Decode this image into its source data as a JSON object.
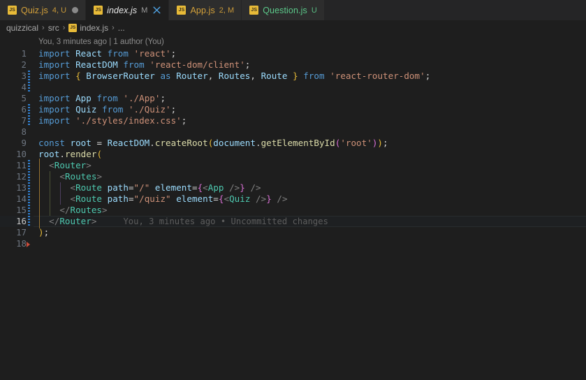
{
  "window": {
    "app": "Visual Studio Code",
    "theme_bg": "#1e1e1e",
    "tabbar_bg": "#252526",
    "accent": "#569cd6"
  },
  "tabs": [
    {
      "label": "Quiz.js",
      "icon": "js-file-icon",
      "badge": "4, U",
      "badge_color": "#d4a13a",
      "label_color": "#d4a13a",
      "active": false,
      "dirty": true,
      "closable": false
    },
    {
      "label": "index.js",
      "icon": "js-file-icon",
      "badge": "M",
      "badge_color": "#a8a8a8",
      "label_color": "#e8e8e8",
      "active": true,
      "dirty": false,
      "closable": true
    },
    {
      "label": "App.js",
      "icon": "js-file-icon",
      "badge": "2, M",
      "badge_color": "#d4a13a",
      "label_color": "#d4a13a",
      "active": false,
      "dirty": false,
      "closable": false
    },
    {
      "label": "Question.js",
      "icon": "js-file-icon",
      "badge": "U",
      "badge_color": "#5cc98a",
      "label_color": "#5cc98a",
      "active": false,
      "dirty": false,
      "closable": false
    }
  ],
  "breadcrumbs": {
    "items": [
      {
        "label": "quizzical",
        "icon": null
      },
      {
        "label": "src",
        "icon": null
      },
      {
        "label": "index.js",
        "icon": "js-file-icon"
      },
      {
        "label": "...",
        "icon": null
      }
    ],
    "separator": "›"
  },
  "blame": {
    "header": "You, 3 minutes ago | 1 author (You)",
    "inline_line": 16,
    "inline_text": "You, 3 minutes ago • Uncommitted changes"
  },
  "editor": {
    "filename": "index.js",
    "language": "javascript",
    "current_line": 16,
    "total_lines": 18,
    "changed_lines": [
      3,
      4,
      6,
      7,
      11,
      12,
      13,
      14,
      15,
      16
    ],
    "lines": [
      {
        "n": 1,
        "tokens": [
          {
            "t": "import",
            "c": "kw"
          },
          {
            "t": " ",
            "c": "punc"
          },
          {
            "t": "React",
            "c": "var"
          },
          {
            "t": " ",
            "c": "punc"
          },
          {
            "t": "from",
            "c": "kw"
          },
          {
            "t": " ",
            "c": "punc"
          },
          {
            "t": "'react'",
            "c": "str"
          },
          {
            "t": ";",
            "c": "punc"
          }
        ]
      },
      {
        "n": 2,
        "tokens": [
          {
            "t": "import",
            "c": "kw"
          },
          {
            "t": " ",
            "c": "punc"
          },
          {
            "t": "ReactDOM",
            "c": "var"
          },
          {
            "t": " ",
            "c": "punc"
          },
          {
            "t": "from",
            "c": "kw"
          },
          {
            "t": " ",
            "c": "punc"
          },
          {
            "t": "'react-dom/client'",
            "c": "str"
          },
          {
            "t": ";",
            "c": "punc"
          }
        ]
      },
      {
        "n": 3,
        "tokens": [
          {
            "t": "import",
            "c": "kw"
          },
          {
            "t": " ",
            "c": "punc"
          },
          {
            "t": "{",
            "c": "brace-y"
          },
          {
            "t": " ",
            "c": "punc"
          },
          {
            "t": "BrowserRouter",
            "c": "var"
          },
          {
            "t": " ",
            "c": "punc"
          },
          {
            "t": "as",
            "c": "kw"
          },
          {
            "t": " ",
            "c": "punc"
          },
          {
            "t": "Router",
            "c": "var"
          },
          {
            "t": ", ",
            "c": "punc"
          },
          {
            "t": "Routes",
            "c": "var"
          },
          {
            "t": ", ",
            "c": "punc"
          },
          {
            "t": "Route",
            "c": "var"
          },
          {
            "t": " ",
            "c": "punc"
          },
          {
            "t": "}",
            "c": "brace-y"
          },
          {
            "t": " ",
            "c": "punc"
          },
          {
            "t": "from",
            "c": "kw"
          },
          {
            "t": " ",
            "c": "punc"
          },
          {
            "t": "'react-router-dom'",
            "c": "str"
          },
          {
            "t": ";",
            "c": "punc"
          }
        ]
      },
      {
        "n": 4,
        "tokens": []
      },
      {
        "n": 5,
        "tokens": [
          {
            "t": "import",
            "c": "kw"
          },
          {
            "t": " ",
            "c": "punc"
          },
          {
            "t": "App",
            "c": "var"
          },
          {
            "t": " ",
            "c": "punc"
          },
          {
            "t": "from",
            "c": "kw"
          },
          {
            "t": " ",
            "c": "punc"
          },
          {
            "t": "'./App'",
            "c": "str"
          },
          {
            "t": ";",
            "c": "punc"
          }
        ]
      },
      {
        "n": 6,
        "tokens": [
          {
            "t": "import",
            "c": "kw"
          },
          {
            "t": " ",
            "c": "punc"
          },
          {
            "t": "Quiz",
            "c": "var"
          },
          {
            "t": " ",
            "c": "punc"
          },
          {
            "t": "from",
            "c": "kw"
          },
          {
            "t": " ",
            "c": "punc"
          },
          {
            "t": "'./Quiz'",
            "c": "str"
          },
          {
            "t": ";",
            "c": "punc"
          }
        ]
      },
      {
        "n": 7,
        "tokens": [
          {
            "t": "import",
            "c": "kw"
          },
          {
            "t": " ",
            "c": "punc"
          },
          {
            "t": "'./styles/index.css'",
            "c": "str"
          },
          {
            "t": ";",
            "c": "punc"
          }
        ]
      },
      {
        "n": 8,
        "tokens": []
      },
      {
        "n": 9,
        "tokens": [
          {
            "t": "const",
            "c": "kw"
          },
          {
            "t": " ",
            "c": "punc"
          },
          {
            "t": "root",
            "c": "var"
          },
          {
            "t": " = ",
            "c": "punc"
          },
          {
            "t": "ReactDOM",
            "c": "var"
          },
          {
            "t": ".",
            "c": "punc"
          },
          {
            "t": "createRoot",
            "c": "func"
          },
          {
            "t": "(",
            "c": "brace-y"
          },
          {
            "t": "document",
            "c": "var"
          },
          {
            "t": ".",
            "c": "punc"
          },
          {
            "t": "getElementById",
            "c": "func"
          },
          {
            "t": "(",
            "c": "brace-m"
          },
          {
            "t": "'root'",
            "c": "str"
          },
          {
            "t": ")",
            "c": "brace-m"
          },
          {
            "t": ")",
            "c": "brace-y"
          },
          {
            "t": ";",
            "c": "punc"
          }
        ]
      },
      {
        "n": 10,
        "tokens": [
          {
            "t": "root",
            "c": "var"
          },
          {
            "t": ".",
            "c": "punc"
          },
          {
            "t": "render",
            "c": "func"
          },
          {
            "t": "(",
            "c": "brace-o"
          }
        ]
      },
      {
        "n": 11,
        "tokens": [
          {
            "t": "  ",
            "c": "punc"
          },
          {
            "t": "<",
            "c": "tagpunc"
          },
          {
            "t": "Router",
            "c": "tag"
          },
          {
            "t": ">",
            "c": "tagpunc"
          }
        ]
      },
      {
        "n": 12,
        "tokens": [
          {
            "t": "    ",
            "c": "punc"
          },
          {
            "t": "<",
            "c": "tagpunc"
          },
          {
            "t": "Routes",
            "c": "tag"
          },
          {
            "t": ">",
            "c": "tagpunc"
          }
        ]
      },
      {
        "n": 13,
        "tokens": [
          {
            "t": "      ",
            "c": "punc"
          },
          {
            "t": "<",
            "c": "tagpunc"
          },
          {
            "t": "Route",
            "c": "tag"
          },
          {
            "t": " ",
            "c": "punc"
          },
          {
            "t": "path",
            "c": "prop"
          },
          {
            "t": "=",
            "c": "punc"
          },
          {
            "t": "\"/\"",
            "c": "str"
          },
          {
            "t": " ",
            "c": "punc"
          },
          {
            "t": "element",
            "c": "prop"
          },
          {
            "t": "=",
            "c": "punc"
          },
          {
            "t": "{",
            "c": "brace-m"
          },
          {
            "t": "<",
            "c": "tagpunc"
          },
          {
            "t": "App",
            "c": "tag"
          },
          {
            "t": " ",
            "c": "punc"
          },
          {
            "t": "/>",
            "c": "tagpunc"
          },
          {
            "t": "}",
            "c": "brace-m"
          },
          {
            "t": " ",
            "c": "punc"
          },
          {
            "t": "/>",
            "c": "tagpunc"
          }
        ]
      },
      {
        "n": 14,
        "tokens": [
          {
            "t": "      ",
            "c": "punc"
          },
          {
            "t": "<",
            "c": "tagpunc"
          },
          {
            "t": "Route",
            "c": "tag"
          },
          {
            "t": " ",
            "c": "punc"
          },
          {
            "t": "path",
            "c": "prop"
          },
          {
            "t": "=",
            "c": "punc"
          },
          {
            "t": "\"/quiz\"",
            "c": "str"
          },
          {
            "t": " ",
            "c": "punc"
          },
          {
            "t": "element",
            "c": "prop"
          },
          {
            "t": "=",
            "c": "punc"
          },
          {
            "t": "{",
            "c": "brace-m"
          },
          {
            "t": "<",
            "c": "tagpunc"
          },
          {
            "t": "Quiz",
            "c": "tag"
          },
          {
            "t": " ",
            "c": "punc"
          },
          {
            "t": "/>",
            "c": "tagpunc"
          },
          {
            "t": "}",
            "c": "brace-m"
          },
          {
            "t": " ",
            "c": "punc"
          },
          {
            "t": "/>",
            "c": "tagpunc"
          }
        ]
      },
      {
        "n": 15,
        "tokens": [
          {
            "t": "    ",
            "c": "punc"
          },
          {
            "t": "</",
            "c": "tagpunc"
          },
          {
            "t": "Routes",
            "c": "tag"
          },
          {
            "t": ">",
            "c": "tagpunc"
          }
        ]
      },
      {
        "n": 16,
        "tokens": [
          {
            "t": "  ",
            "c": "punc"
          },
          {
            "t": "</",
            "c": "tagpunc"
          },
          {
            "t": "Router",
            "c": "tag"
          },
          {
            "t": ">",
            "c": "tagpunc"
          }
        ]
      },
      {
        "n": 17,
        "tokens": [
          {
            "t": ")",
            "c": "brace-o"
          },
          {
            "t": ";",
            "c": "punc"
          }
        ]
      },
      {
        "n": 18,
        "tokens": []
      }
    ]
  }
}
